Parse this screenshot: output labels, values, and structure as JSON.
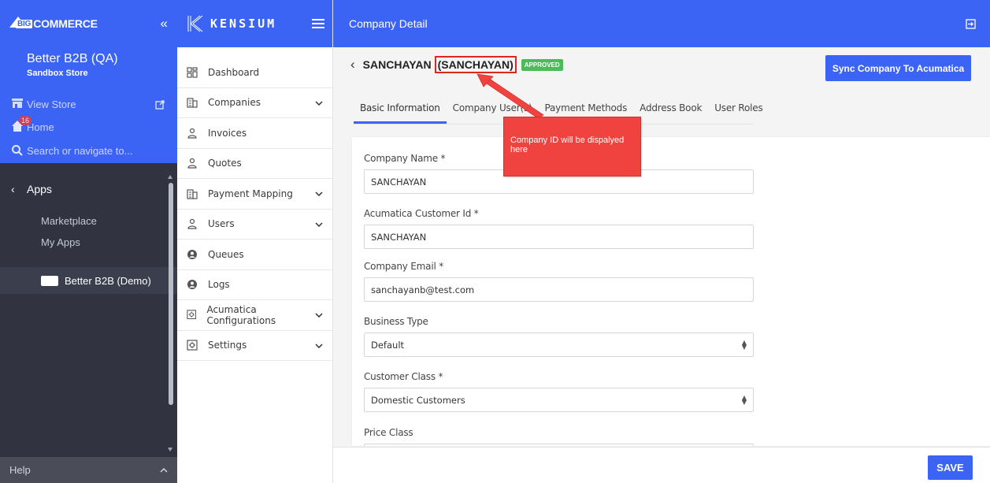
{
  "bigcommerce": {
    "logo_big": "BIG",
    "logo_rest": "COMMERCE",
    "collapse": "«",
    "store_name": "Better B2B (QA)",
    "store_type": "Sandbox Store",
    "view_store": "View Store",
    "home": "Home",
    "home_badge": "16",
    "search_placeholder": "Search or navigate to...",
    "apps_label": "Apps",
    "marketplace": "Marketplace",
    "my_apps": "My Apps",
    "app_item": "Better B2B (Demo)",
    "help": "Help",
    "help_chevron": "^"
  },
  "kensium": {
    "logo_text": "KENSIUM",
    "nav": [
      {
        "label": "Dashboard",
        "icon": "dashboard-icon",
        "chevron": false
      },
      {
        "label": "Companies",
        "icon": "building-icon",
        "chevron": true
      },
      {
        "label": "Invoices",
        "icon": "user-icon",
        "chevron": false
      },
      {
        "label": "Quotes",
        "icon": "user-icon",
        "chevron": false
      },
      {
        "label": "Payment Mapping",
        "icon": "building-icon",
        "chevron": true
      },
      {
        "label": "Users",
        "icon": "user-icon",
        "chevron": true
      },
      {
        "label": "Queues",
        "icon": "account-circle-icon",
        "chevron": false
      },
      {
        "label": "Logs",
        "icon": "account-circle-icon",
        "chevron": false
      },
      {
        "label": "Acumatica Configurations",
        "icon": "settings-box-icon",
        "chevron": true
      },
      {
        "label": "Settings",
        "icon": "settings-box-icon",
        "chevron": true
      }
    ]
  },
  "main": {
    "header_title": "Company Detail",
    "company_name": "SANCHAYAN",
    "company_id": "(SANCHAYAN)",
    "status_badge": "APPROVED",
    "sync_button": "Sync Company To Acumatica",
    "tabs": [
      "Basic Information",
      "Company User(s)",
      "Payment Methods",
      "Address Book",
      "User Roles"
    ],
    "active_tab": "Basic Information",
    "fields": {
      "company_name": {
        "label": "Company Name *",
        "value": "SANCHAYAN"
      },
      "acumatica_customer_id": {
        "label": "Acumatica Customer Id *",
        "value": "SANCHAYAN"
      },
      "company_email": {
        "label": "Company Email *",
        "value": "sanchayanb@test.com"
      },
      "business_type": {
        "label": "Business Type",
        "value": "Default"
      },
      "customer_class": {
        "label": "Customer Class *",
        "value": "Domestic Customers"
      },
      "price_class": {
        "label": "Price Class",
        "value": ""
      }
    },
    "save_button": "SAVE"
  },
  "annotation": {
    "text": "Company ID will be dispalyed here",
    "color": "#f0433f"
  },
  "colors": {
    "brand_blue": "#3c64f4",
    "sidebar_dark": "#313440",
    "approved_green": "#4cbb5a"
  }
}
